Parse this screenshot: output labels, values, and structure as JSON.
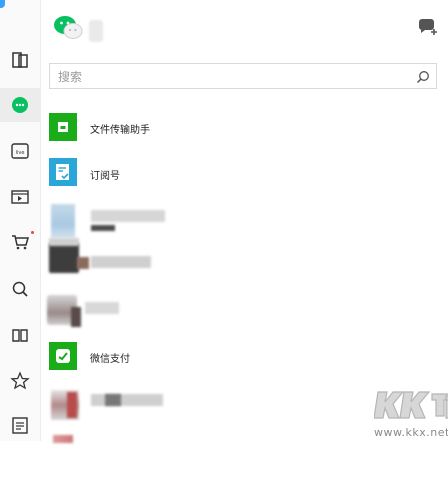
{
  "search": {
    "placeholder": "搜索"
  },
  "chats": [
    {
      "name": "文件传输助手"
    },
    {
      "name": "订阅号"
    },
    {
      "name": "微信支付"
    }
  ],
  "watermark": {
    "logo": "KK下载",
    "url": "www.kkx.net"
  },
  "colors": {
    "accent": "#07c160",
    "file_helper": "#1aad19",
    "subscription": "#2aa6d9"
  }
}
